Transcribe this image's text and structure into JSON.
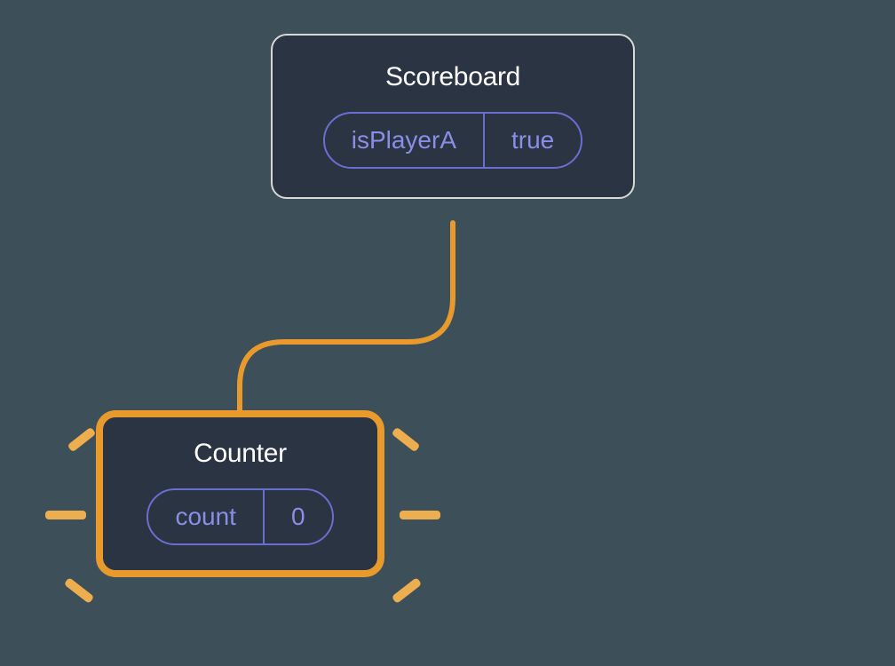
{
  "parent": {
    "title": "Scoreboard",
    "stateKey": "isPlayerA",
    "stateValue": "true"
  },
  "child": {
    "title": "Counter",
    "stateKey": "count",
    "stateValue": "0"
  },
  "colors": {
    "background": "#3d4f58",
    "nodeBg": "#2b3442",
    "nodeBorder": "#d8d8d8",
    "highlight": "#e99a2c",
    "sparkle": "#ecae4f",
    "pillBorder": "#6a6ed1",
    "pillText": "#8a8ee6",
    "titleText": "#ffffff",
    "connector": "#e99a2c"
  }
}
